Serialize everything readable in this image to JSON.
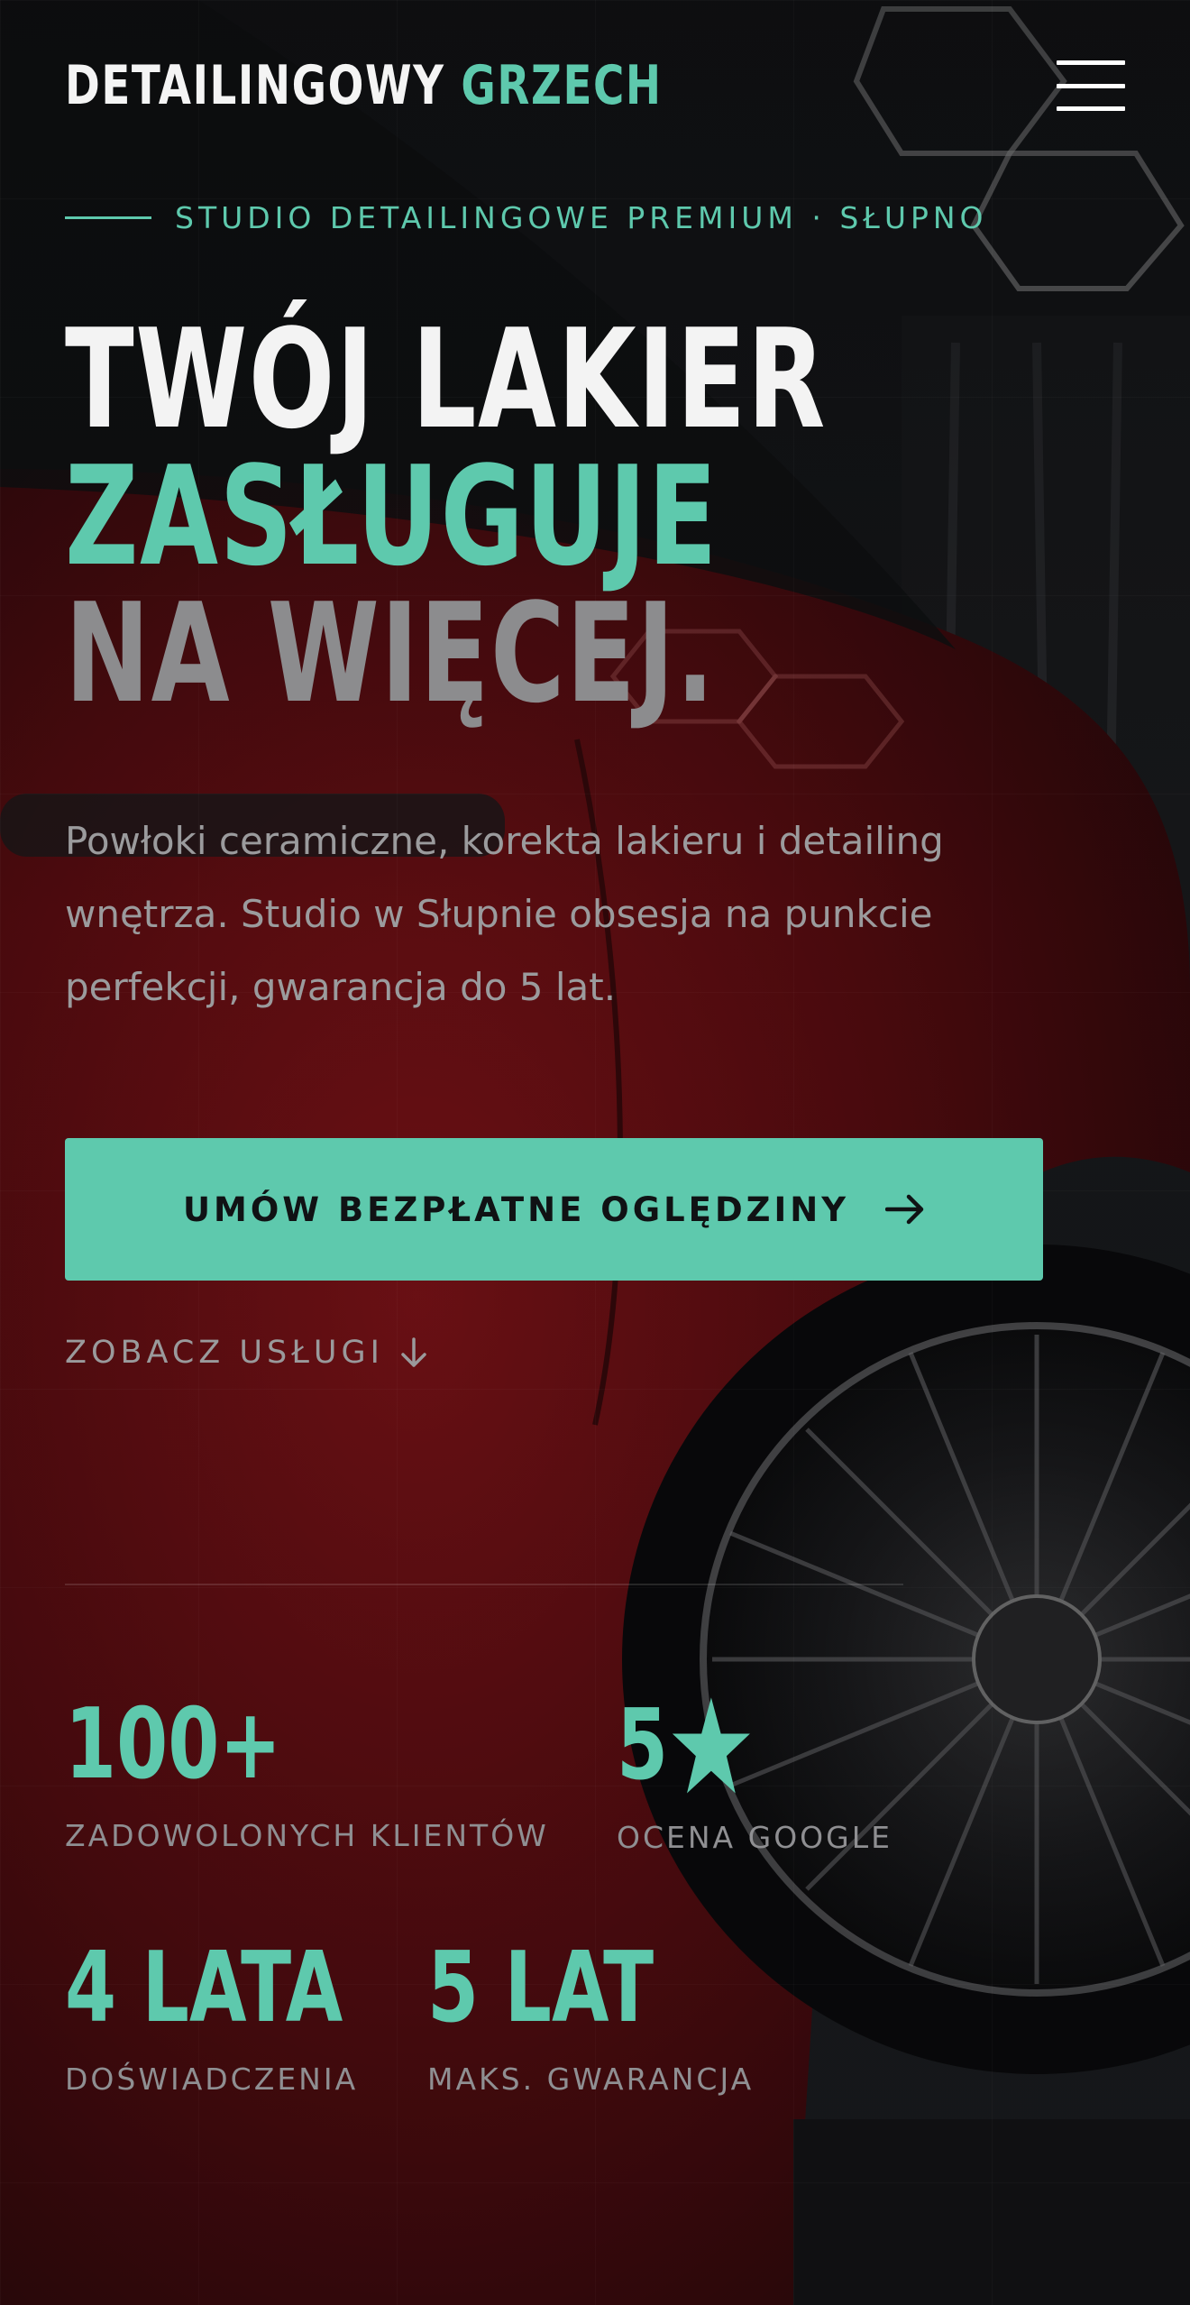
{
  "brand": {
    "name": "DETAILINGOWY",
    "name_accent": "GRZECH"
  },
  "eyebrow": "STUDIO DETAILINGOWE PREMIUM · SŁUPNO",
  "hero": {
    "line1": "TWÓJ LAKIER",
    "line2": "ZASŁUGUJE",
    "line3": "NA WIĘCEJ.",
    "lead": "Powłoki ceramiczne, korekta lakieru i detailing wnętrza. Studio w Słupnie obsesja na punkcie perfekcji, gwarancja do 5 lat."
  },
  "cta": {
    "primary_label": "UMÓW BEZPŁATNE OGLĘDZINY",
    "secondary_label": "ZOBACZ USŁUGI"
  },
  "stats": [
    {
      "value": "100+",
      "label": "ZADOWOLONYCH KLIENTÓW"
    },
    {
      "value": "5",
      "label": "OCENA GOOGLE",
      "icon": "star-icon"
    },
    {
      "value": "4 LATA",
      "label": "DOŚWIADCZENIA"
    },
    {
      "value": "5 LAT",
      "label": "MAKS. GWARANCJA"
    }
  ],
  "colors": {
    "accent": "#5ec9ad",
    "background": "#0c0d0f",
    "car_red": "#8a0f14"
  }
}
